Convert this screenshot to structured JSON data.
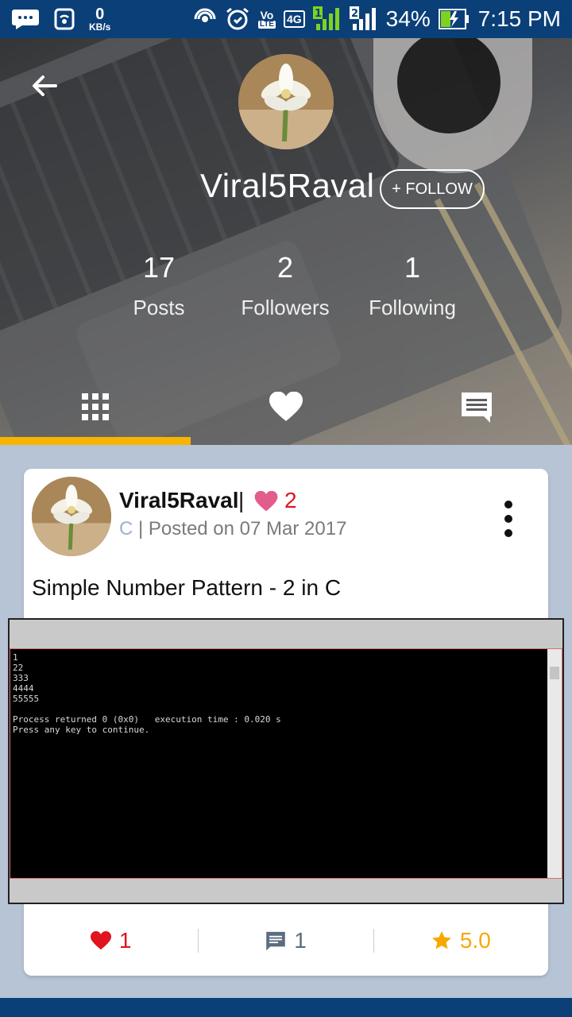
{
  "status_bar": {
    "speed_value": "0",
    "speed_unit": "KB/s",
    "volte_top": "Vo",
    "volte_bottom": "LTE",
    "network": "4G",
    "sim1": "1",
    "sim2": "2",
    "battery": "34%",
    "time": "7:15 PM"
  },
  "profile": {
    "username": "Viral5Raval",
    "follow_label": "+ FOLLOW",
    "stats": [
      {
        "value": "17",
        "label": "Posts"
      },
      {
        "value": "2",
        "label": "Followers"
      },
      {
        "value": "1",
        "label": "Following"
      }
    ],
    "tabs": [
      "grid-icon",
      "heart-icon",
      "comment-icon"
    ],
    "active_tab": 0
  },
  "post": {
    "author": "Viral5Raval",
    "separator": "|",
    "likes_badge": "2",
    "language": "C",
    "posted_text": " | Posted on 07 Mar 2017",
    "title": "Simple Number Pattern - 2 in C",
    "console_output": "1\n22\n333\n4444\n55555\n\nProcess returned 0 (0x0)   execution time : 0.020 s\nPress any key to continue.",
    "actions": {
      "likes": "1",
      "comments": "1",
      "rating": "5.0"
    }
  },
  "colors": {
    "status_bar": "#0b3f78",
    "tab_indicator": "#f7b500",
    "heart": "#e0141e",
    "star": "#f7a800",
    "comment": "#5a6c80",
    "page_bg": "#b7c4d6"
  }
}
